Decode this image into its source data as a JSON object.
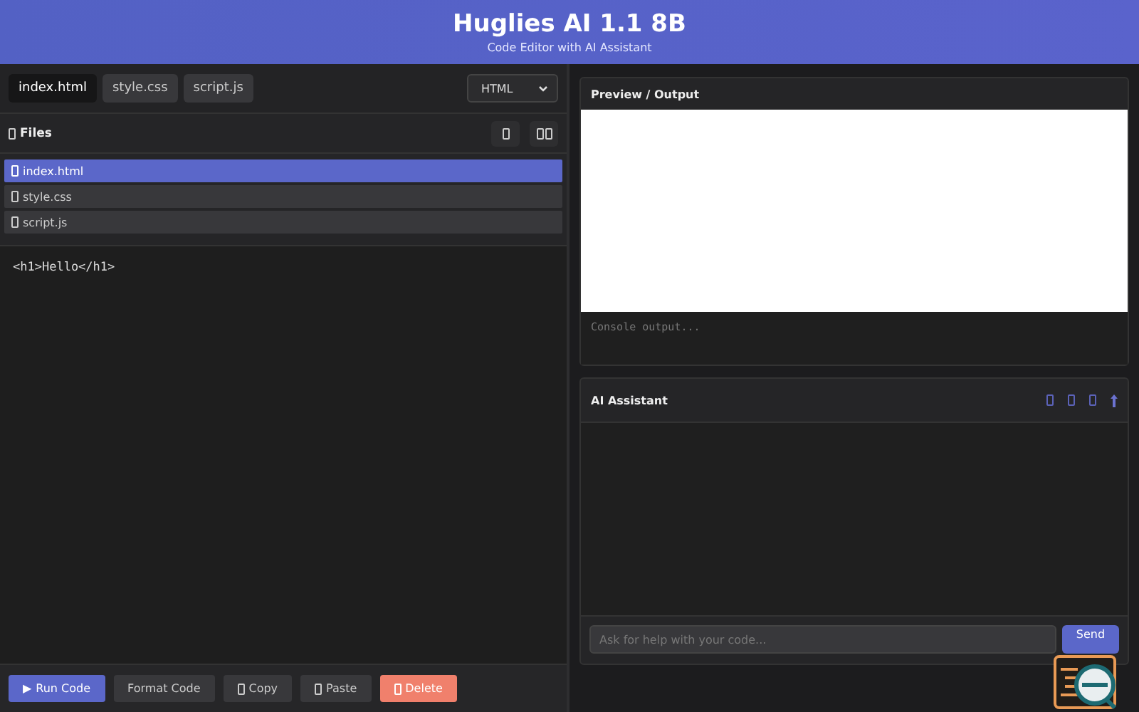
{
  "header": {
    "title": "Huglies AI 1.1 8B",
    "subtitle": "Code Editor with AI Assistant"
  },
  "tabs": [
    {
      "label": "index.html",
      "selected": true
    },
    {
      "label": "style.css",
      "selected": false
    },
    {
      "label": "script.js",
      "selected": false
    }
  ],
  "language_select": {
    "value": "HTML"
  },
  "files": {
    "title": "Files",
    "items": [
      {
        "name": "index.html",
        "selected": true
      },
      {
        "name": "style.css",
        "selected": false
      },
      {
        "name": "script.js",
        "selected": false
      }
    ]
  },
  "editor": {
    "code": "<h1>Hello</h1>"
  },
  "actions": [
    {
      "label": "Run Code",
      "kind": "primary",
      "icon": "▶"
    },
    {
      "label": "Format Code",
      "kind": "plain"
    },
    {
      "label": "Copy",
      "kind": "glyph"
    },
    {
      "label": "Paste",
      "kind": "glyph"
    },
    {
      "label": "Delete",
      "kind": "danger"
    }
  ],
  "preview": {
    "title": "Preview / Output",
    "console_placeholder": "Console output..."
  },
  "assistant": {
    "title": "AI Assistant",
    "input_placeholder": "Ask for help with your code...",
    "send_label": "Send"
  }
}
